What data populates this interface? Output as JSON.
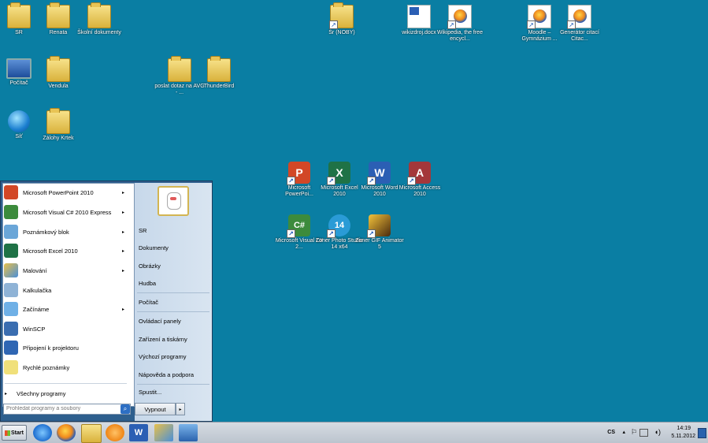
{
  "desktop_icons": [
    {
      "label": "SR",
      "icon": "user-folder-icon"
    },
    {
      "label": "Renata",
      "icon": "user-folder-icon"
    },
    {
      "label": "Školní dokumenty",
      "icon": "folder-icon"
    },
    {
      "label": "Šr (NOBY)",
      "icon": "folder-shortcut-icon"
    },
    {
      "label": "wikizdroj.docx",
      "icon": "word-doc-icon"
    },
    {
      "label": "Wikipedia, the free encycl...",
      "icon": "firefox-link-icon"
    },
    {
      "label": "Moodle – Gymnázium ...",
      "icon": "firefox-link-icon"
    },
    {
      "label": "Generátor citací Citac...",
      "icon": "firefox-link-icon"
    },
    {
      "label": "Počítač",
      "icon": "computer-icon"
    },
    {
      "label": "Vendula",
      "icon": "user-folder-icon"
    },
    {
      "label": "poslat dotaz na AVG - ...",
      "icon": "folder-icon"
    },
    {
      "label": "ThunderBird",
      "icon": "folder-icon"
    },
    {
      "label": "Síť",
      "icon": "network-icon"
    },
    {
      "label": "Zálohy Krtek",
      "icon": "folder-icon"
    },
    {
      "label": "Microsoft PowerPoi...",
      "icon": "powerpoint-icon"
    },
    {
      "label": "Microsoft Excel 2010",
      "icon": "excel-icon"
    },
    {
      "label": "Microsoft Word 2010",
      "icon": "word-icon"
    },
    {
      "label": "Microsoft Access 2010",
      "icon": "access-icon"
    },
    {
      "label": "Microsoft Visual C# 2...",
      "icon": "visual-csharp-icon"
    },
    {
      "label": "Zoner Photo Studio 14 x64",
      "icon": "zoner-photo-icon"
    },
    {
      "label": "Zoner GIF Animator 5",
      "icon": "zoner-gif-icon"
    }
  ],
  "start_menu": {
    "programs": [
      {
        "label": "Microsoft PowerPoint 2010",
        "submenu": "▸",
        "icon": "powerpoint-icon"
      },
      {
        "label": "Microsoft Visual C# 2010 Express",
        "submenu": "▸",
        "icon": "visual-csharp-icon"
      },
      {
        "label": "Poznámkový blok",
        "submenu": "▸",
        "icon": "notepad-icon"
      },
      {
        "label": "Microsoft Excel 2010",
        "submenu": "▸",
        "icon": "excel-icon"
      },
      {
        "label": "Malování",
        "submenu": "▸",
        "icon": "paint-icon"
      },
      {
        "label": "Kalkulačka",
        "submenu": "",
        "icon": "calculator-icon"
      },
      {
        "label": "Začínáme",
        "submenu": "▸",
        "icon": "getting-started-icon"
      },
      {
        "label": "WinSCP",
        "submenu": "",
        "icon": "winscp-icon"
      },
      {
        "label": "Připojení k projektoru",
        "submenu": "",
        "icon": "projector-icon"
      },
      {
        "label": "Rychlé poznámky",
        "submenu": "",
        "icon": "sticky-notes-icon"
      }
    ],
    "all_programs": "Všechny programy",
    "all_programs_arrow": "▸",
    "search_placeholder": "Prohledat programy a soubory",
    "right_items": [
      "SR",
      "Dokumenty",
      "Obrázky",
      "Hudba",
      "Počítač",
      "Ovládací panely",
      "Zařízení a tiskárny",
      "Výchozí programy",
      "Nápověda a podpora",
      "Spustit..."
    ],
    "shutdown_label": "Vypnout",
    "shutdown_arrow": "▸"
  },
  "taskbar": {
    "start_label": "Start",
    "pinned": [
      "internet-explorer-icon",
      "firefox-icon",
      "explorer-folder-icon",
      "media-player-icon",
      "word-icon",
      "paint-icon",
      "remote-desktop-icon"
    ],
    "language": "CS",
    "time": "14:19",
    "date": "5.11.2012"
  },
  "colors": {
    "desktop": "#0a7ea3",
    "start_menu_frame": "#2e5f8e"
  }
}
